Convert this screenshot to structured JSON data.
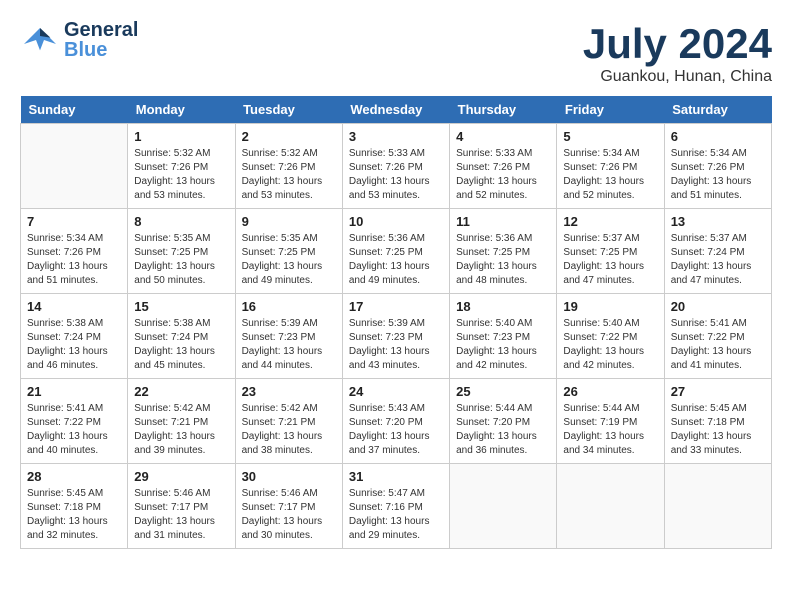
{
  "header": {
    "logo_general": "General",
    "logo_blue": "Blue",
    "title": "July 2024",
    "subtitle": "Guankou, Hunan, China"
  },
  "days_of_week": [
    "Sunday",
    "Monday",
    "Tuesday",
    "Wednesday",
    "Thursday",
    "Friday",
    "Saturday"
  ],
  "weeks": [
    [
      {
        "day": "",
        "info": ""
      },
      {
        "day": "1",
        "info": "Sunrise: 5:32 AM\nSunset: 7:26 PM\nDaylight: 13 hours\nand 53 minutes."
      },
      {
        "day": "2",
        "info": "Sunrise: 5:32 AM\nSunset: 7:26 PM\nDaylight: 13 hours\nand 53 minutes."
      },
      {
        "day": "3",
        "info": "Sunrise: 5:33 AM\nSunset: 7:26 PM\nDaylight: 13 hours\nand 53 minutes."
      },
      {
        "day": "4",
        "info": "Sunrise: 5:33 AM\nSunset: 7:26 PM\nDaylight: 13 hours\nand 52 minutes."
      },
      {
        "day": "5",
        "info": "Sunrise: 5:34 AM\nSunset: 7:26 PM\nDaylight: 13 hours\nand 52 minutes."
      },
      {
        "day": "6",
        "info": "Sunrise: 5:34 AM\nSunset: 7:26 PM\nDaylight: 13 hours\nand 51 minutes."
      }
    ],
    [
      {
        "day": "7",
        "info": "Sunrise: 5:34 AM\nSunset: 7:26 PM\nDaylight: 13 hours\nand 51 minutes."
      },
      {
        "day": "8",
        "info": "Sunrise: 5:35 AM\nSunset: 7:25 PM\nDaylight: 13 hours\nand 50 minutes."
      },
      {
        "day": "9",
        "info": "Sunrise: 5:35 AM\nSunset: 7:25 PM\nDaylight: 13 hours\nand 49 minutes."
      },
      {
        "day": "10",
        "info": "Sunrise: 5:36 AM\nSunset: 7:25 PM\nDaylight: 13 hours\nand 49 minutes."
      },
      {
        "day": "11",
        "info": "Sunrise: 5:36 AM\nSunset: 7:25 PM\nDaylight: 13 hours\nand 48 minutes."
      },
      {
        "day": "12",
        "info": "Sunrise: 5:37 AM\nSunset: 7:25 PM\nDaylight: 13 hours\nand 47 minutes."
      },
      {
        "day": "13",
        "info": "Sunrise: 5:37 AM\nSunset: 7:24 PM\nDaylight: 13 hours\nand 47 minutes."
      }
    ],
    [
      {
        "day": "14",
        "info": "Sunrise: 5:38 AM\nSunset: 7:24 PM\nDaylight: 13 hours\nand 46 minutes."
      },
      {
        "day": "15",
        "info": "Sunrise: 5:38 AM\nSunset: 7:24 PM\nDaylight: 13 hours\nand 45 minutes."
      },
      {
        "day": "16",
        "info": "Sunrise: 5:39 AM\nSunset: 7:23 PM\nDaylight: 13 hours\nand 44 minutes."
      },
      {
        "day": "17",
        "info": "Sunrise: 5:39 AM\nSunset: 7:23 PM\nDaylight: 13 hours\nand 43 minutes."
      },
      {
        "day": "18",
        "info": "Sunrise: 5:40 AM\nSunset: 7:23 PM\nDaylight: 13 hours\nand 42 minutes."
      },
      {
        "day": "19",
        "info": "Sunrise: 5:40 AM\nSunset: 7:22 PM\nDaylight: 13 hours\nand 42 minutes."
      },
      {
        "day": "20",
        "info": "Sunrise: 5:41 AM\nSunset: 7:22 PM\nDaylight: 13 hours\nand 41 minutes."
      }
    ],
    [
      {
        "day": "21",
        "info": "Sunrise: 5:41 AM\nSunset: 7:22 PM\nDaylight: 13 hours\nand 40 minutes."
      },
      {
        "day": "22",
        "info": "Sunrise: 5:42 AM\nSunset: 7:21 PM\nDaylight: 13 hours\nand 39 minutes."
      },
      {
        "day": "23",
        "info": "Sunrise: 5:42 AM\nSunset: 7:21 PM\nDaylight: 13 hours\nand 38 minutes."
      },
      {
        "day": "24",
        "info": "Sunrise: 5:43 AM\nSunset: 7:20 PM\nDaylight: 13 hours\nand 37 minutes."
      },
      {
        "day": "25",
        "info": "Sunrise: 5:44 AM\nSunset: 7:20 PM\nDaylight: 13 hours\nand 36 minutes."
      },
      {
        "day": "26",
        "info": "Sunrise: 5:44 AM\nSunset: 7:19 PM\nDaylight: 13 hours\nand 34 minutes."
      },
      {
        "day": "27",
        "info": "Sunrise: 5:45 AM\nSunset: 7:18 PM\nDaylight: 13 hours\nand 33 minutes."
      }
    ],
    [
      {
        "day": "28",
        "info": "Sunrise: 5:45 AM\nSunset: 7:18 PM\nDaylight: 13 hours\nand 32 minutes."
      },
      {
        "day": "29",
        "info": "Sunrise: 5:46 AM\nSunset: 7:17 PM\nDaylight: 13 hours\nand 31 minutes."
      },
      {
        "day": "30",
        "info": "Sunrise: 5:46 AM\nSunset: 7:17 PM\nDaylight: 13 hours\nand 30 minutes."
      },
      {
        "day": "31",
        "info": "Sunrise: 5:47 AM\nSunset: 7:16 PM\nDaylight: 13 hours\nand 29 minutes."
      },
      {
        "day": "",
        "info": ""
      },
      {
        "day": "",
        "info": ""
      },
      {
        "day": "",
        "info": ""
      }
    ]
  ]
}
